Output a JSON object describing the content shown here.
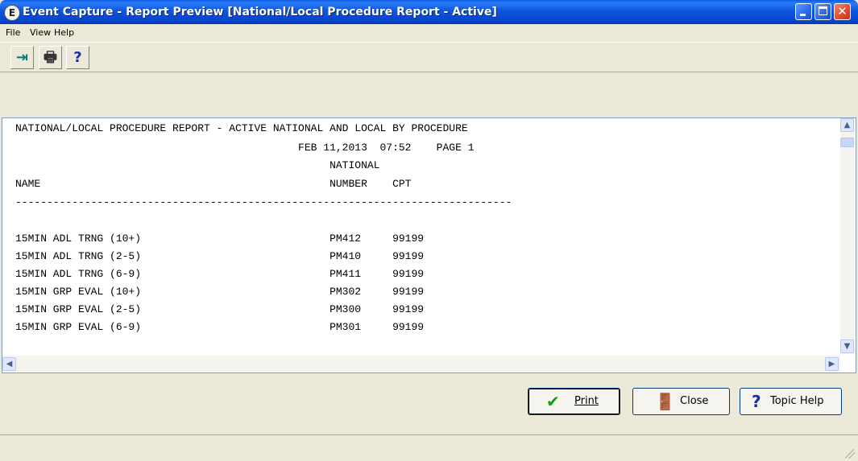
{
  "window": {
    "title": "Event Capture - Report Preview [National/Local Procedure Report - Active]",
    "app_icon": "E",
    "controls": {
      "minimize": "minimize-icon",
      "maximize": "maximize-icon",
      "close": "close-icon"
    }
  },
  "menu": [
    {
      "label": "File"
    },
    {
      "label": "View"
    },
    {
      "label": "Help"
    }
  ],
  "toolbar": {
    "exit": {
      "icon": "exit-door-icon",
      "glyph": "⇥"
    },
    "print": {
      "icon": "printer-icon",
      "glyph": "🖶"
    },
    "help": {
      "icon": "question-icon",
      "glyph": "?"
    }
  },
  "report": {
    "lines": [
      "NATIONAL/LOCAL PROCEDURE REPORT - ACTIVE NATIONAL AND LOCAL BY PROCEDURE",
      "                                             FEB 11,2013  07:52    PAGE 1",
      "                                                  NATIONAL",
      "NAME                                              NUMBER    CPT",
      "-------------------------------------------------------------------------------",
      "",
      "15MIN ADL TRNG (10+)                              PM412     99199",
      "15MIN ADL TRNG (2-5)                              PM410     99199",
      "15MIN ADL TRNG (6-9)                              PM411     99199",
      "15MIN GRP EVAL (10+)                              PM302     99199",
      "15MIN GRP EVAL (2-5)                              PM300     99199",
      "15MIN GRP EVAL (6-9)                              PM301     99199"
    ]
  },
  "buttons": {
    "print": {
      "label": "Print",
      "icon": "checkmark-icon",
      "glyph": "✔"
    },
    "close": {
      "label": "Close",
      "icon": "door-exit-icon",
      "glyph": "🚪"
    },
    "topic_help": {
      "label": "Topic Help",
      "icon": "question-icon",
      "glyph": "?"
    }
  },
  "scroll_glyphs": {
    "up": "▲",
    "down": "▼",
    "left": "◀",
    "right": "▶"
  }
}
